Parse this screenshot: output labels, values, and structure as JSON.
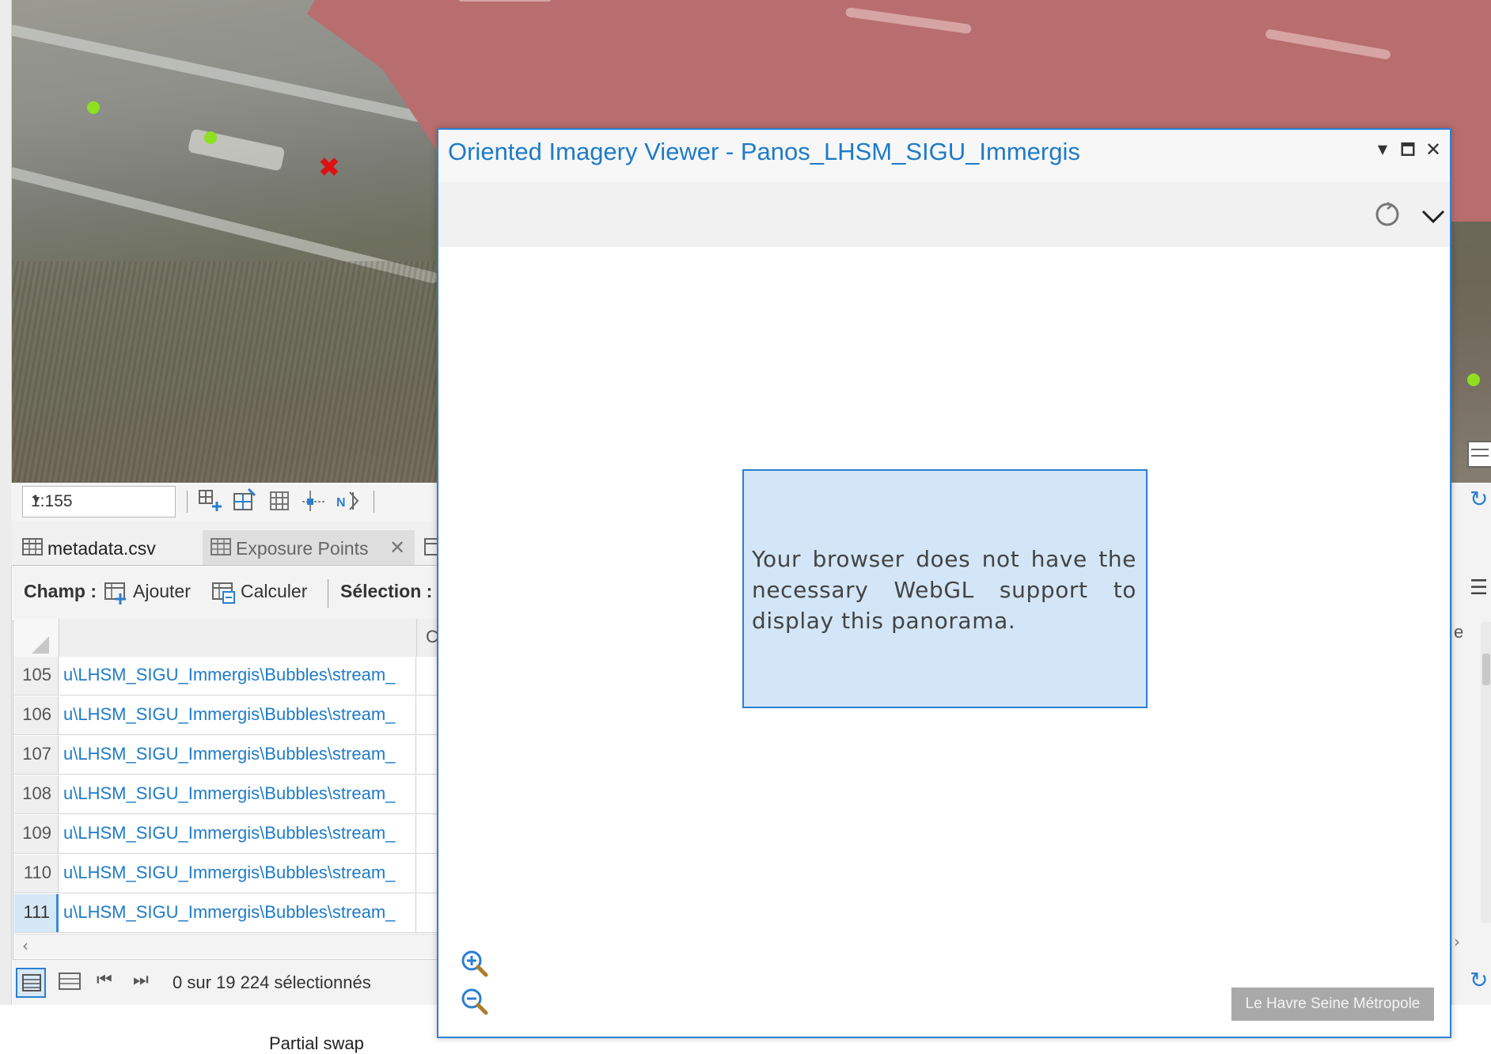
{
  "map": {
    "scale": "1:155"
  },
  "tabs": [
    {
      "label": "metadata.csv"
    },
    {
      "label": "Exposure Points"
    }
  ],
  "field_bar": {
    "champ_label": "Champ :",
    "add_label": "Ajouter",
    "calc_label": "Calculer",
    "selection_label": "Sélection :"
  },
  "table": {
    "partial_header_left": "C",
    "partial_header_right": "e",
    "rows": [
      {
        "num": "105",
        "path": "u\\LHSM_SIGU_Immergis\\Bubbles\\stream_"
      },
      {
        "num": "106",
        "path": "u\\LHSM_SIGU_Immergis\\Bubbles\\stream_"
      },
      {
        "num": "107",
        "path": "u\\LHSM_SIGU_Immergis\\Bubbles\\stream_"
      },
      {
        "num": "108",
        "path": "u\\LHSM_SIGU_Immergis\\Bubbles\\stream_"
      },
      {
        "num": "109",
        "path": "u\\LHSM_SIGU_Immergis\\Bubbles\\stream_"
      },
      {
        "num": "110",
        "path": "u\\LHSM_SIGU_Immergis\\Bubbles\\stream_"
      },
      {
        "num": "111",
        "path": "u\\LHSM_SIGU_Immergis\\Bubbles\\stream_"
      }
    ],
    "selected_row": "111",
    "status": "0 sur 19 224 sélectionnés"
  },
  "viewer": {
    "title": "Oriented Imagery Viewer - Panos_LHSM_SIGU_Immergis",
    "message": "Your browser does not have the necessary WebGL support to display this panorama.",
    "credit": "Le Havre Seine Métropole"
  },
  "bottom": {
    "partial_text": "Partial swap"
  },
  "colors": {
    "accent": "#1e7bc8",
    "window_border": "#2f7fd6",
    "message_bg": "#d3e6f7",
    "map_red_zone": "#b86e6e",
    "marker_green": "#8ee021",
    "marker_x": "#dd1111"
  }
}
